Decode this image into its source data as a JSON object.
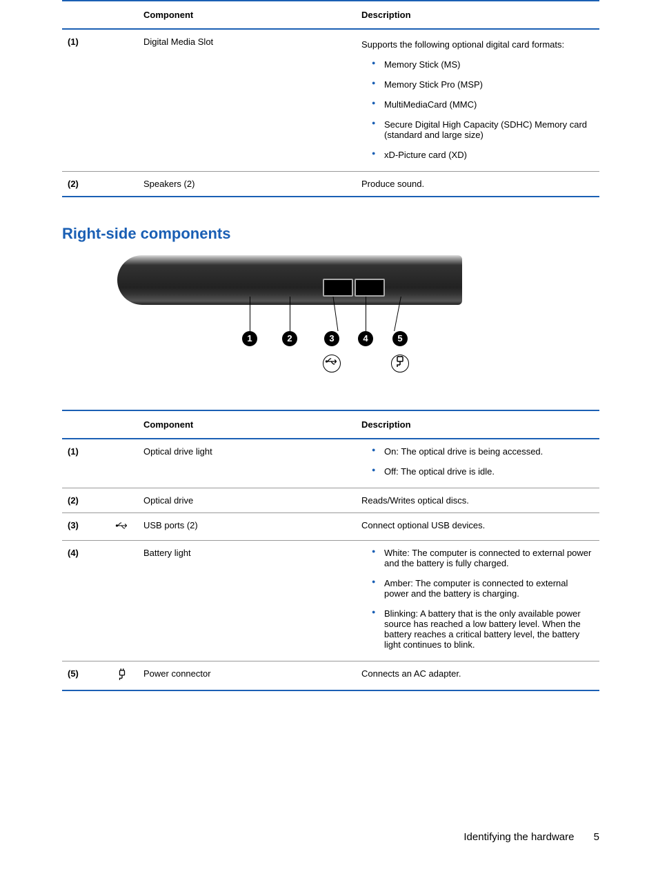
{
  "table1": {
    "headers": {
      "component": "Component",
      "description": "Description"
    },
    "rows": [
      {
        "num": "(1)",
        "component": "Digital Media Slot",
        "intro": "Supports the following optional digital card formats:",
        "bullets": [
          "Memory Stick (MS)",
          "Memory Stick Pro (MSP)",
          "MultiMediaCard (MMC)",
          "Secure Digital High Capacity (SDHC) Memory card (standard and large size)",
          "xD-Picture card (XD)"
        ]
      },
      {
        "num": "(2)",
        "component": "Speakers (2)",
        "description": "Produce sound."
      }
    ]
  },
  "section2": {
    "heading": "Right-side components"
  },
  "table2": {
    "headers": {
      "component": "Component",
      "description": "Description"
    },
    "rows": [
      {
        "num": "(1)",
        "component": "Optical drive light",
        "bullets": [
          "On: The optical drive is being accessed.",
          "Off: The optical drive is idle."
        ]
      },
      {
        "num": "(2)",
        "component": "Optical drive",
        "description": "Reads/Writes optical discs."
      },
      {
        "num": "(3)",
        "component": "USB ports (2)",
        "description": "Connect optional USB devices."
      },
      {
        "num": "(4)",
        "component": "Battery light",
        "bullets": [
          "White: The computer is connected to external power and the battery is fully charged.",
          "Amber: The computer is connected to external power and the battery is charging.",
          "Blinking: A battery that is the only available power source has reached a low battery level. When the battery reaches a critical battery level, the battery light continues to blink."
        ]
      },
      {
        "num": "(5)",
        "component": "Power connector",
        "description": "Connects an AC adapter."
      }
    ]
  },
  "footer": {
    "section": "Identifying the hardware",
    "page": "5"
  },
  "callouts": [
    "1",
    "2",
    "3",
    "4",
    "5"
  ]
}
